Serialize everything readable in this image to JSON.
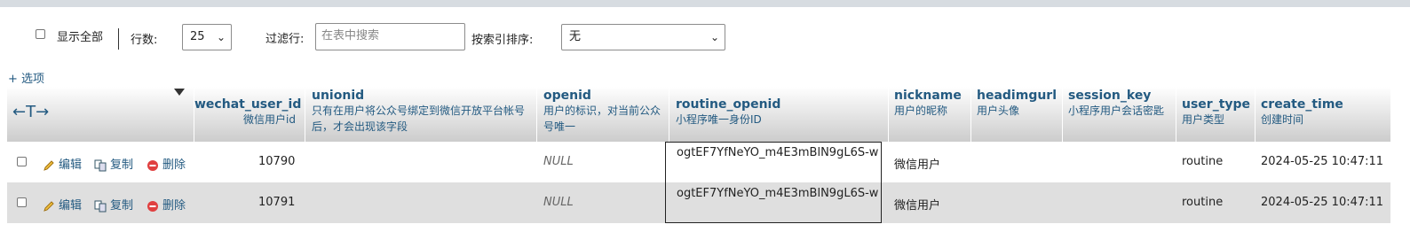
{
  "controls": {
    "show_all_label": "显示全部",
    "rows_label": "行数:",
    "rows_value": "25",
    "filter_label": "过滤行:",
    "filter_placeholder": "在表中搜索",
    "sort_label": "按索引排序:",
    "sort_value": "无"
  },
  "options_link": "+ 选项",
  "header": {
    "nav_arrows": "←T→",
    "columns": [
      {
        "name": "wechat_user_id",
        "comment": "微信用户id"
      },
      {
        "name": "unionid",
        "comment": "只有在用户将公众号绑定到微信开放平台帐号后，才会出现该字段"
      },
      {
        "name": "openid",
        "comment": "用户的标识，对当前公众号唯一"
      },
      {
        "name": "routine_openid",
        "comment": "小程序唯一身份ID"
      },
      {
        "name": "nickname",
        "comment": "用户的昵称"
      },
      {
        "name": "headimgurl",
        "comment": "用户头像"
      },
      {
        "name": "session_key",
        "comment": "小程序用户会话密匙"
      },
      {
        "name": "user_type",
        "comment": "用户类型"
      },
      {
        "name": "create_time",
        "comment": "创建时间"
      }
    ]
  },
  "actions": {
    "edit": "编辑",
    "copy": "复制",
    "delete": "删除"
  },
  "rows": [
    {
      "wechat_user_id": "10790",
      "openid": "NULL",
      "routine_openid": "ogtEF7YfNeYO_m4E3mBlN9gL6S-w",
      "nickname": "微信用户",
      "user_type": "routine",
      "create_time": "2024-05-25 10:47:11"
    },
    {
      "wechat_user_id": "10791",
      "openid": "NULL",
      "routine_openid": "ogtEF7YfNeYO_m4E3mBlN9gL6S-w",
      "nickname": "微信用户",
      "user_type": "routine",
      "create_time": "2024-05-25 10:47:11"
    }
  ],
  "colors": {
    "link": "#235a81",
    "row_alt": "#dfdfdf"
  }
}
